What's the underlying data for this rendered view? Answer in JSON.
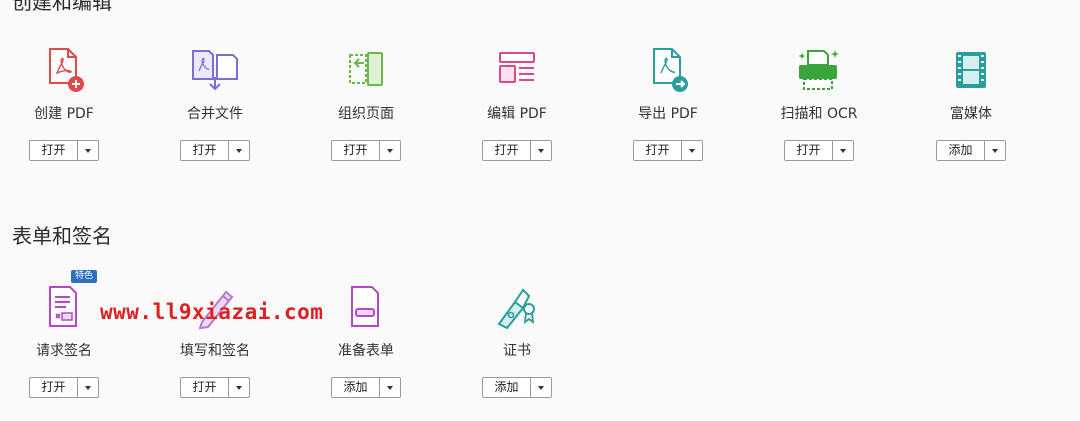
{
  "sections": [
    {
      "title": "创建和编辑",
      "tools": [
        {
          "label": "创建 PDF",
          "button": "打开",
          "icon": "create-pdf-icon"
        },
        {
          "label": "合并文件",
          "button": "打开",
          "icon": "combine-files-icon"
        },
        {
          "label": "组织页面",
          "button": "打开",
          "icon": "organize-pages-icon"
        },
        {
          "label": "编辑 PDF",
          "button": "打开",
          "icon": "edit-pdf-icon"
        },
        {
          "label": "导出 PDF",
          "button": "打开",
          "icon": "export-pdf-icon"
        },
        {
          "label": "扫描和 OCR",
          "button": "打开",
          "icon": "scan-ocr-icon"
        },
        {
          "label": "富媒体",
          "button": "添加",
          "icon": "rich-media-icon"
        }
      ]
    },
    {
      "title": "表单和签名",
      "tools": [
        {
          "label": "请求签名",
          "button": "打开",
          "icon": "request-signature-icon",
          "badge": "特色"
        },
        {
          "label": "填写和签名",
          "button": "打开",
          "icon": "fill-sign-icon"
        },
        {
          "label": "准备表单",
          "button": "添加",
          "icon": "prepare-form-icon"
        },
        {
          "label": "证书",
          "button": "添加",
          "icon": "certificates-icon"
        }
      ]
    }
  ],
  "watermark": "www.ll9xiazai.com",
  "colors": {
    "create": "#e04a4a",
    "combine": "#7b6fd6",
    "organize": "#6ab94a",
    "edit": "#d94a8c",
    "export": "#2a9d9d",
    "scan": "#3aa53a",
    "media": "#2a9d9d",
    "sign": "#b548c6",
    "badge": "#2d6fc4",
    "watermark": "#e02020"
  }
}
